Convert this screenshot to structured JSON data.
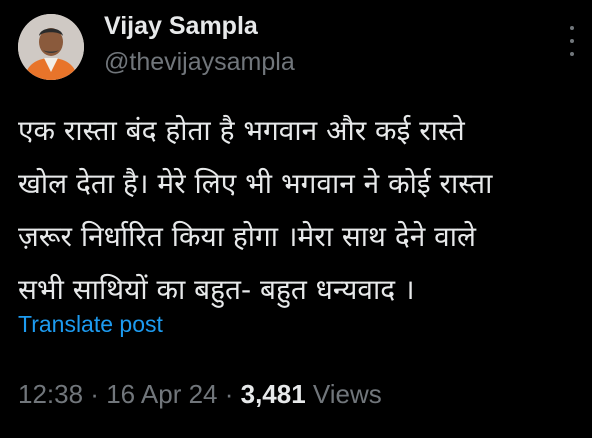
{
  "author": {
    "display_name": "Vijay Sampla",
    "handle": "@thevijaysampla"
  },
  "tweet": {
    "lines": [
      "एक रास्ता बंद होता है भगवान और कई रास्ते",
      "खोल देता है। मेरे लिए भी भगवान ने कोई रास्ता",
      "ज़रूर निर्धारित किया होगा ।मेरा साथ देने वाले",
      "सभी साथियों का बहुत- बहुत धन्यवाद ।"
    ],
    "translate_label": "Translate post"
  },
  "meta": {
    "time": "12:38",
    "sep1": " · ",
    "date": "16 Apr 24",
    "sep2": " · ",
    "views_count": "3,481",
    "views_label": " Views"
  },
  "colors": {
    "background": "#000000",
    "text": "#e7e9ea",
    "muted": "#71767b",
    "link": "#1d9bf0"
  },
  "icons": {
    "more": "more-vertical-icon"
  }
}
